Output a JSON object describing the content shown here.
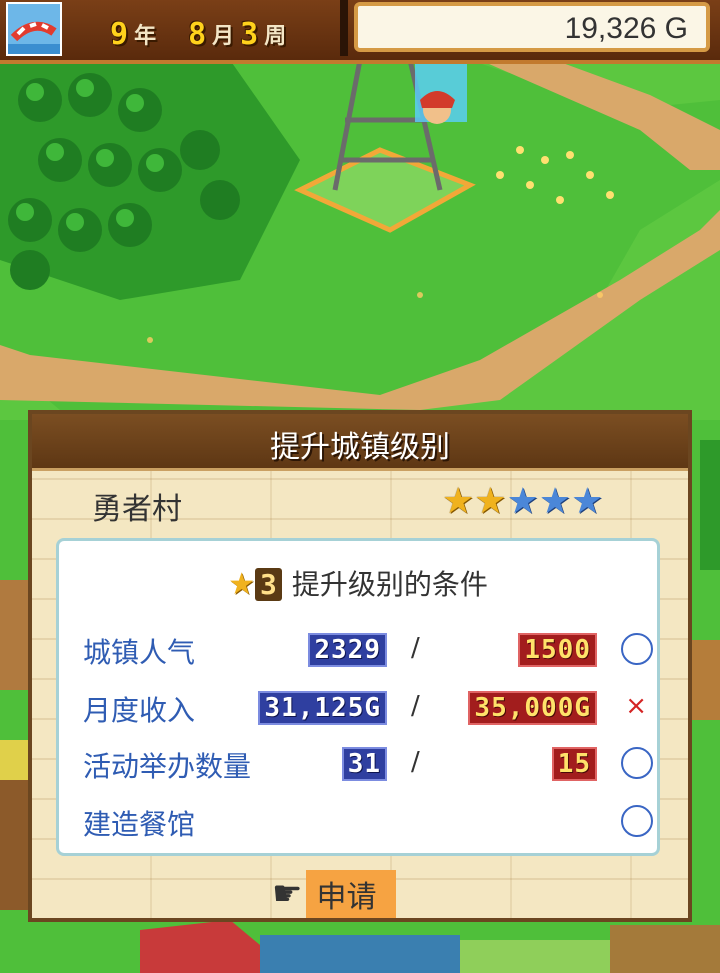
{
  "hud": {
    "year_num": "9",
    "year_unit": "年",
    "month_num": "8",
    "month_unit": "月",
    "week_num": "3",
    "week_unit": "周",
    "gold": "19,326 G",
    "menu_icon": "lifebuoy-icon"
  },
  "dialog": {
    "title": "提升城镇级别",
    "town_name": "勇者村",
    "stars_filled": 2,
    "stars_total": 5,
    "conditions_title": "提升级别的条件",
    "next_level": "3",
    "conditions": [
      {
        "label": "城镇人气",
        "current": "2329",
        "required": "1500",
        "met": true
      },
      {
        "label": "月度收入",
        "current": "31,125G",
        "required": "35,000G",
        "met": false
      },
      {
        "label": "活动举办数量",
        "current": "31",
        "required": "15",
        "met": true
      },
      {
        "label": "建造餐馆",
        "current": "",
        "required": "",
        "met": true
      }
    ],
    "slash": "/",
    "ok_mark": "○",
    "ng_mark": "×",
    "apply_label": "申请",
    "apply_icon": "pointing-hand-icon"
  },
  "colors": {
    "accent_orange": "#f6a342",
    "title_bar": "#6b4620",
    "label_blue": "#2f5cb3",
    "fail_red": "#d42424"
  }
}
